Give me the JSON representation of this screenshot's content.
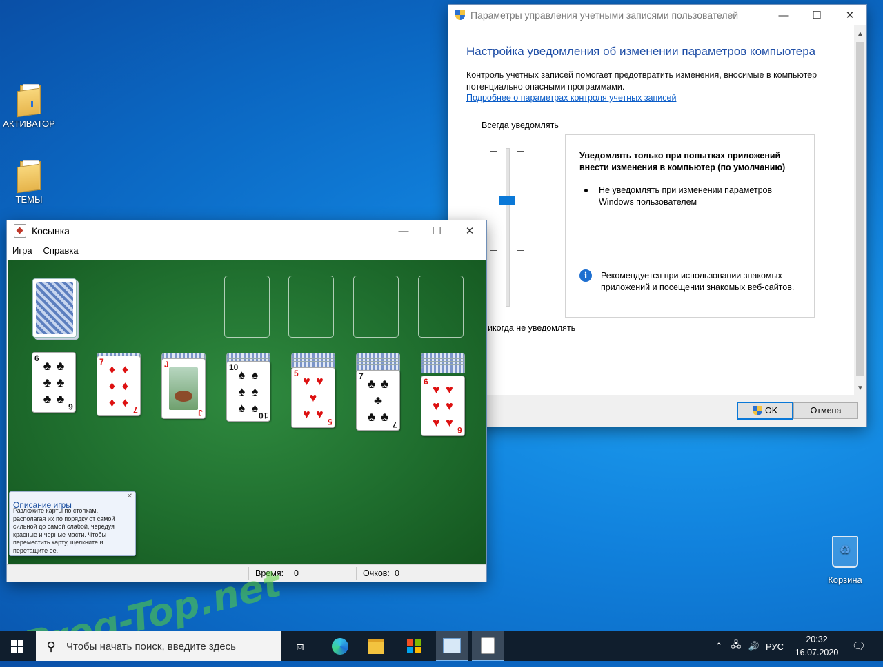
{
  "desktop": {
    "icons": [
      {
        "label": "АКТИВАТОР"
      },
      {
        "label": "ТЕМЫ"
      },
      {
        "label": "Корзина"
      }
    ],
    "watermark": "Prog-Top.net"
  },
  "uac": {
    "title": "Параметры управления учетными записями пользователей",
    "heading": "Настройка уведомления об изменении параметров компьютера",
    "description": "Контроль учетных записей помогает предотвратить изменения, вносимые в компьютер потенциально опасными программами.",
    "link": "Подробнее о параметрах контроля учетных записей",
    "always_label": "Всегда уведомлять",
    "never_label": "Никогда не уведомлять",
    "slider_level": 3,
    "slider_levels": 4,
    "info_title": "Уведомлять только при попытках приложений внести изменения в компьютер (по умолчанию)",
    "info_bullet": "Не уведомлять при изменении параметров Windows пользователем",
    "recommendation": "Рекомендуется при использовании знакомых приложений и посещении знакомых веб-сайтов.",
    "ok_label": "OK",
    "cancel_label": "Отмена"
  },
  "solitaire": {
    "title": "Косынка",
    "menu": [
      "Игра",
      "Справка"
    ],
    "tableau": [
      {
        "rank": "6",
        "suit": "♣",
        "color": "black"
      },
      {
        "rank": "7",
        "suit": "♦",
        "color": "red"
      },
      {
        "rank": "J",
        "suit": "♦",
        "color": "red"
      },
      {
        "rank": "10",
        "suit": "♠",
        "color": "black"
      },
      {
        "rank": "5",
        "suit": "♥",
        "color": "red"
      },
      {
        "rank": "7",
        "suit": "♣",
        "color": "black"
      },
      {
        "rank": "6",
        "suit": "♥",
        "color": "red"
      }
    ],
    "help_title": "Описание игры",
    "help_text": "Разложите карты по стопкам, располагая их по порядку от самой сильной до самой слабой, чередуя красные и черные масти. Чтобы переместить карту, щелкните и перетащите ее.",
    "time_label": "Время:",
    "time_value": "0",
    "score_label": "Очков:",
    "score_value": "0"
  },
  "taskbar": {
    "search_placeholder": "Чтобы начать поиск, введите здесь",
    "language": "РУС",
    "time": "20:32",
    "date": "16.07.2020"
  }
}
